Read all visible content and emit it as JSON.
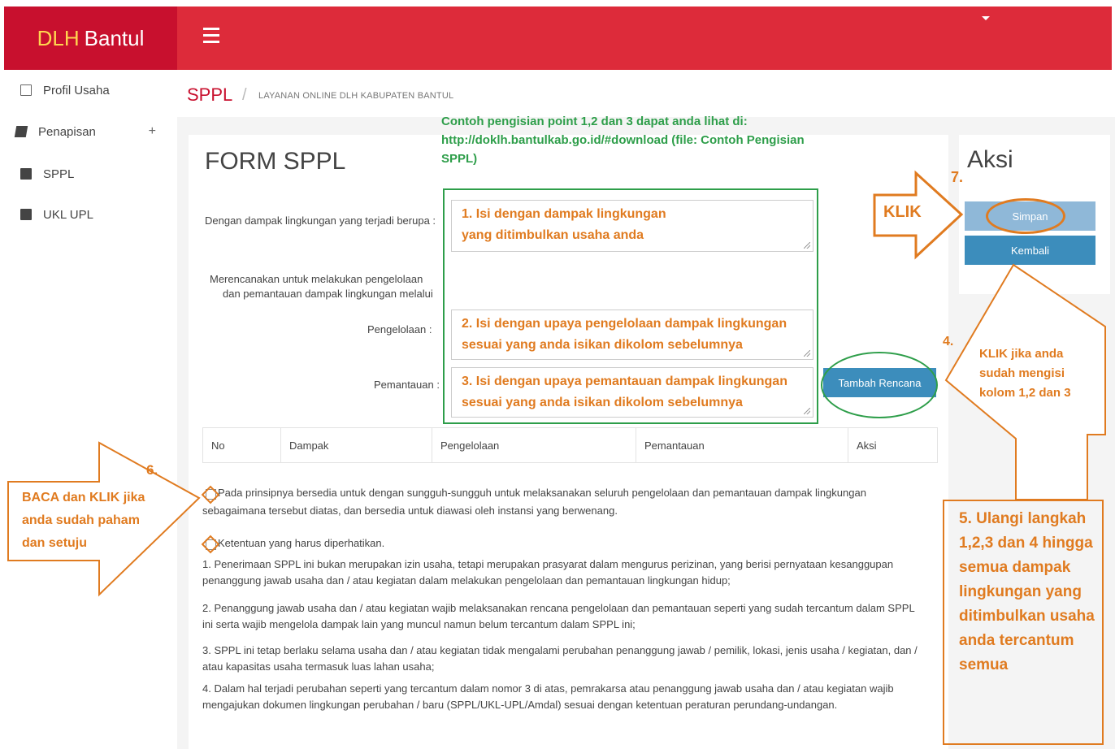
{
  "header": {
    "brand_prefix": "DLH",
    "brand_suffix": "Bantul"
  },
  "sidebar": {
    "items": [
      {
        "label": "Profil Usaha",
        "icon": "document-icon"
      },
      {
        "label": "Penapisan",
        "icon": "book-icon",
        "expand": "+"
      },
      {
        "label": "SPPL",
        "icon": "folder-icon"
      },
      {
        "label": "UKL UPL",
        "icon": "folder-icon"
      }
    ]
  },
  "breadcrumb": {
    "title": "SPPL",
    "separator": "/",
    "subtitle": "LAYANAN ONLINE DLH KABUPATEN BANTUL"
  },
  "form": {
    "title": "FORM SPPL",
    "label_dampak": "Dengan dampak lingkungan yang terjadi berupa :",
    "label_rencana_1": "Merencanakan untuk melakukan pengelolaan",
    "label_rencana_2": "dan pemantauan dampak lingkungan melalui",
    "label_pengelolaan": "Pengelolaan :",
    "label_pemantauan": "Pemantauan :",
    "tambah_button": "Tambah Rencana",
    "table_headers": [
      "No",
      "Dampak",
      "Pengelolaan",
      "Pemantauan",
      "Aksi"
    ],
    "agree_1a": "Pada prinsipnya bersedia untuk dengan sungguh-sungguh untuk melaksanakan seluruh pengelolaan dan pemantauan dampak lingkungan",
    "agree_1b": "sebagaimana tersebut diatas, dan bersedia untuk diawasi oleh instansi yang berwenang.",
    "agree_2": "Ketentuan yang harus diperhatikan.",
    "rules": [
      [
        "1. Penerimaan SPPL ini bukan merupakan izin usaha, tetapi merupakan prasyarat dalam mengurus perizinan, yang berisi pernyataan kesanggupan",
        "penanggung jawab usaha dan / atau kegiatan dalam melakukan pengelolaan dan pemantauan lingkungan hidup;"
      ],
      [
        "2. Penanggung jawab usaha dan / atau kegiatan wajib melaksanakan rencana pengelolaan dan pemantauan seperti yang sudah tercantum dalam SPPL",
        "ini serta wajib mengelola dampak lain yang muncul namun belum tercantum dalam SPPL ini;"
      ],
      [
        "3. SPPL ini tetap berlaku selama usaha dan / atau kegiatan tidak mengalami perubahan penanggung jawab / pemilik, lokasi, jenis usaha / kegiatan, dan /",
        "atau kapasitas usaha termasuk luas lahan usaha;"
      ],
      [
        "4. Dalam hal terjadi perubahan seperti yang tercantum dalam nomor 3 di atas, pemrakarsa atau penanggung jawab usaha dan / atau kegiatan wajib",
        "mengajukan dokumen lingkungan perubahan / baru (SPPL/UKL-UPL/Amdal) sesuai dengan ketentuan peraturan perundang-undangan."
      ]
    ]
  },
  "aksi": {
    "title": "Aksi",
    "simpan": "Simpan",
    "kembali": "Kembali"
  },
  "annotations": {
    "green_note": [
      "Contoh pengisian point 1,2 dan 3 dapat anda lihat di:",
      "http://doklh.bantulkab.go.id/#download (file: Contoh Pengisian",
      "SPPL)"
    ],
    "step1": [
      "1. Isi dengan dampak lingkungan",
      "yang ditimbulkan usaha anda"
    ],
    "step2": [
      "2. Isi dengan upaya pengelolaan dampak lingkungan",
      "sesuai yang anda isikan dikolom sebelumnya"
    ],
    "step3": [
      "3. Isi dengan upaya pemantauan dampak lingkungan",
      "sesuai yang anda isikan dikolom sebelumnya"
    ],
    "step4_num": "4.",
    "step4": [
      "KLIK jika anda",
      "sudah mengisi",
      "kolom 1,2 dan 3"
    ],
    "step5": [
      "5. Ulangi langkah",
      "1,2,3 dan 4 hingga",
      "semua dampak",
      "lingkungan yang",
      "ditimbulkan usaha",
      "anda tercantum",
      "semua"
    ],
    "step6_num": "6.",
    "step6": [
      "BACA dan KLIK jika",
      "anda sudah paham",
      "dan setuju"
    ],
    "step7_num": "7.",
    "klik": "KLIK"
  },
  "colors": {
    "brand": "#c8102e",
    "topbar": "#dd2b3a",
    "button": "#3c8dbc",
    "annotation_orange": "#e07b20",
    "annotation_green": "#2e9e4a"
  }
}
